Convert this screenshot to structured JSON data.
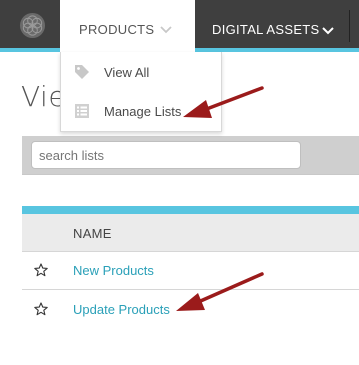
{
  "nav": {
    "products_label": "PRODUCTS",
    "digital_assets_label": "DIGITAL ASSETS"
  },
  "dropdown": {
    "items": [
      {
        "label": "View All",
        "icon": "tag-icon"
      },
      {
        "label": "Manage Lists",
        "icon": "list-icon"
      }
    ]
  },
  "page": {
    "title": "Vie"
  },
  "search": {
    "placeholder": "search lists"
  },
  "table": {
    "column_name": "NAME",
    "rows": [
      {
        "name": "New Products"
      },
      {
        "name": "Update Products"
      }
    ]
  },
  "colors": {
    "topbar": "#3f3f3f",
    "accent": "#58c5e0",
    "link": "#2aa0b8",
    "annotation_arrow": "#9b1b1b"
  }
}
